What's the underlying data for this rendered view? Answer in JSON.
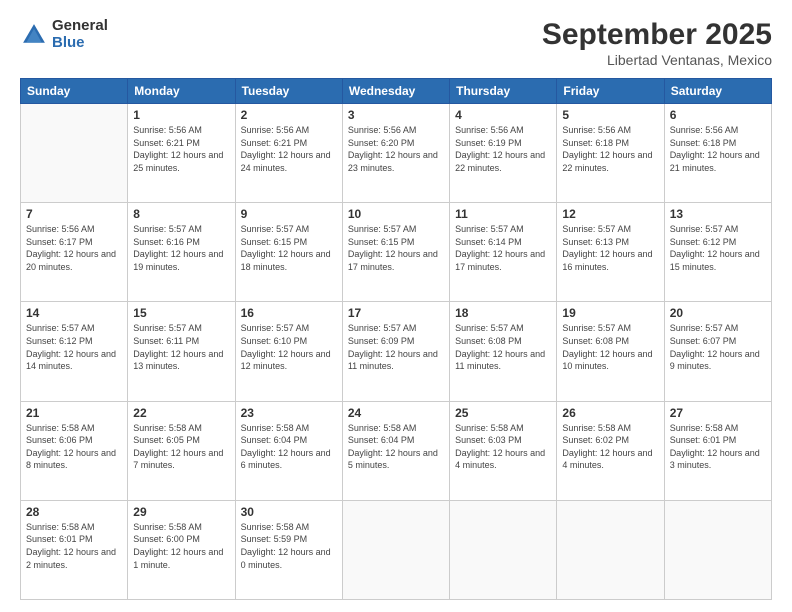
{
  "logo": {
    "general": "General",
    "blue": "Blue"
  },
  "header": {
    "month": "September 2025",
    "location": "Libertad Ventanas, Mexico"
  },
  "days_of_week": [
    "Sunday",
    "Monday",
    "Tuesday",
    "Wednesday",
    "Thursday",
    "Friday",
    "Saturday"
  ],
  "weeks": [
    [
      {
        "num": "",
        "sunrise": "",
        "sunset": "",
        "daylight": ""
      },
      {
        "num": "1",
        "sunrise": "Sunrise: 5:56 AM",
        "sunset": "Sunset: 6:21 PM",
        "daylight": "Daylight: 12 hours and 25 minutes."
      },
      {
        "num": "2",
        "sunrise": "Sunrise: 5:56 AM",
        "sunset": "Sunset: 6:21 PM",
        "daylight": "Daylight: 12 hours and 24 minutes."
      },
      {
        "num": "3",
        "sunrise": "Sunrise: 5:56 AM",
        "sunset": "Sunset: 6:20 PM",
        "daylight": "Daylight: 12 hours and 23 minutes."
      },
      {
        "num": "4",
        "sunrise": "Sunrise: 5:56 AM",
        "sunset": "Sunset: 6:19 PM",
        "daylight": "Daylight: 12 hours and 22 minutes."
      },
      {
        "num": "5",
        "sunrise": "Sunrise: 5:56 AM",
        "sunset": "Sunset: 6:18 PM",
        "daylight": "Daylight: 12 hours and 22 minutes."
      },
      {
        "num": "6",
        "sunrise": "Sunrise: 5:56 AM",
        "sunset": "Sunset: 6:18 PM",
        "daylight": "Daylight: 12 hours and 21 minutes."
      }
    ],
    [
      {
        "num": "7",
        "sunrise": "Sunrise: 5:56 AM",
        "sunset": "Sunset: 6:17 PM",
        "daylight": "Daylight: 12 hours and 20 minutes."
      },
      {
        "num": "8",
        "sunrise": "Sunrise: 5:57 AM",
        "sunset": "Sunset: 6:16 PM",
        "daylight": "Daylight: 12 hours and 19 minutes."
      },
      {
        "num": "9",
        "sunrise": "Sunrise: 5:57 AM",
        "sunset": "Sunset: 6:15 PM",
        "daylight": "Daylight: 12 hours and 18 minutes."
      },
      {
        "num": "10",
        "sunrise": "Sunrise: 5:57 AM",
        "sunset": "Sunset: 6:15 PM",
        "daylight": "Daylight: 12 hours and 17 minutes."
      },
      {
        "num": "11",
        "sunrise": "Sunrise: 5:57 AM",
        "sunset": "Sunset: 6:14 PM",
        "daylight": "Daylight: 12 hours and 17 minutes."
      },
      {
        "num": "12",
        "sunrise": "Sunrise: 5:57 AM",
        "sunset": "Sunset: 6:13 PM",
        "daylight": "Daylight: 12 hours and 16 minutes."
      },
      {
        "num": "13",
        "sunrise": "Sunrise: 5:57 AM",
        "sunset": "Sunset: 6:12 PM",
        "daylight": "Daylight: 12 hours and 15 minutes."
      }
    ],
    [
      {
        "num": "14",
        "sunrise": "Sunrise: 5:57 AM",
        "sunset": "Sunset: 6:12 PM",
        "daylight": "Daylight: 12 hours and 14 minutes."
      },
      {
        "num": "15",
        "sunrise": "Sunrise: 5:57 AM",
        "sunset": "Sunset: 6:11 PM",
        "daylight": "Daylight: 12 hours and 13 minutes."
      },
      {
        "num": "16",
        "sunrise": "Sunrise: 5:57 AM",
        "sunset": "Sunset: 6:10 PM",
        "daylight": "Daylight: 12 hours and 12 minutes."
      },
      {
        "num": "17",
        "sunrise": "Sunrise: 5:57 AM",
        "sunset": "Sunset: 6:09 PM",
        "daylight": "Daylight: 12 hours and 11 minutes."
      },
      {
        "num": "18",
        "sunrise": "Sunrise: 5:57 AM",
        "sunset": "Sunset: 6:08 PM",
        "daylight": "Daylight: 12 hours and 11 minutes."
      },
      {
        "num": "19",
        "sunrise": "Sunrise: 5:57 AM",
        "sunset": "Sunset: 6:08 PM",
        "daylight": "Daylight: 12 hours and 10 minutes."
      },
      {
        "num": "20",
        "sunrise": "Sunrise: 5:57 AM",
        "sunset": "Sunset: 6:07 PM",
        "daylight": "Daylight: 12 hours and 9 minutes."
      }
    ],
    [
      {
        "num": "21",
        "sunrise": "Sunrise: 5:58 AM",
        "sunset": "Sunset: 6:06 PM",
        "daylight": "Daylight: 12 hours and 8 minutes."
      },
      {
        "num": "22",
        "sunrise": "Sunrise: 5:58 AM",
        "sunset": "Sunset: 6:05 PM",
        "daylight": "Daylight: 12 hours and 7 minutes."
      },
      {
        "num": "23",
        "sunrise": "Sunrise: 5:58 AM",
        "sunset": "Sunset: 6:04 PM",
        "daylight": "Daylight: 12 hours and 6 minutes."
      },
      {
        "num": "24",
        "sunrise": "Sunrise: 5:58 AM",
        "sunset": "Sunset: 6:04 PM",
        "daylight": "Daylight: 12 hours and 5 minutes."
      },
      {
        "num": "25",
        "sunrise": "Sunrise: 5:58 AM",
        "sunset": "Sunset: 6:03 PM",
        "daylight": "Daylight: 12 hours and 4 minutes."
      },
      {
        "num": "26",
        "sunrise": "Sunrise: 5:58 AM",
        "sunset": "Sunset: 6:02 PM",
        "daylight": "Daylight: 12 hours and 4 minutes."
      },
      {
        "num": "27",
        "sunrise": "Sunrise: 5:58 AM",
        "sunset": "Sunset: 6:01 PM",
        "daylight": "Daylight: 12 hours and 3 minutes."
      }
    ],
    [
      {
        "num": "28",
        "sunrise": "Sunrise: 5:58 AM",
        "sunset": "Sunset: 6:01 PM",
        "daylight": "Daylight: 12 hours and 2 minutes."
      },
      {
        "num": "29",
        "sunrise": "Sunrise: 5:58 AM",
        "sunset": "Sunset: 6:00 PM",
        "daylight": "Daylight: 12 hours and 1 minute."
      },
      {
        "num": "30",
        "sunrise": "Sunrise: 5:58 AM",
        "sunset": "Sunset: 5:59 PM",
        "daylight": "Daylight: 12 hours and 0 minutes."
      },
      {
        "num": "",
        "sunrise": "",
        "sunset": "",
        "daylight": ""
      },
      {
        "num": "",
        "sunrise": "",
        "sunset": "",
        "daylight": ""
      },
      {
        "num": "",
        "sunrise": "",
        "sunset": "",
        "daylight": ""
      },
      {
        "num": "",
        "sunrise": "",
        "sunset": "",
        "daylight": ""
      }
    ]
  ]
}
